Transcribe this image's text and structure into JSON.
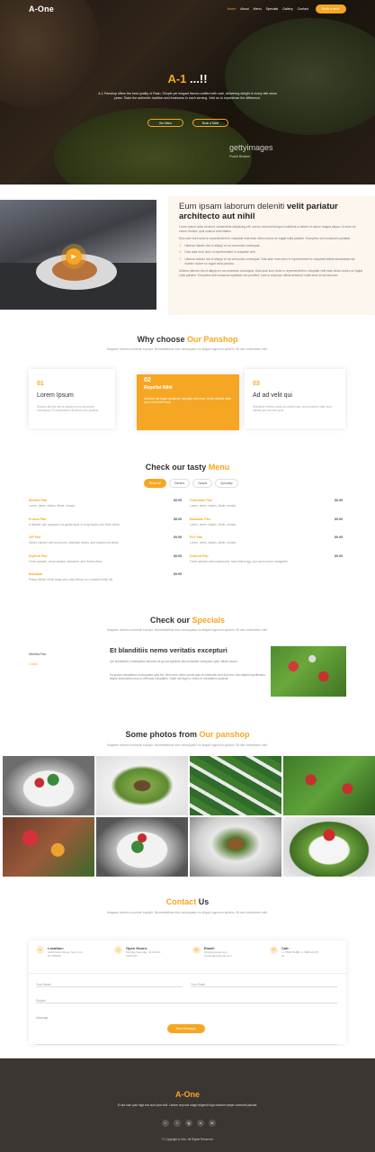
{
  "header": {
    "logo": "A-One",
    "nav": [
      "Home",
      "About",
      "Menu",
      "Specials",
      "Gallery",
      "Contact"
    ],
    "book_button": "Book a table"
  },
  "hero": {
    "title_main": "A-1",
    "title_rest": " ...!!",
    "text": "A-1 Panshop offers the best quality of Paan. Simple yet elegant flavors crafted with care, delivering delight in every bite since years. Taste the authentic tradition and freshness in each serving. Visit us to experience the difference.",
    "btn1": "Our Menu",
    "btn2": "Book a Table",
    "watermark": "gettyimages",
    "watermark_sub": "Pulkit Bhasin"
  },
  "about": {
    "heading_plain": "Eum ipsam laborum deleniti ",
    "heading_bold": "velit pariatur architecto aut nihil",
    "p1": "Lorem ipsum dolor sit amet, consectetur adipiscing elit, sed do eiusmod tempor incididunt ut labore et dolore magna aliqua. Ut enim ad minim veniam, quis nostrud exercitation.",
    "p2": "Duis aute irure dolor in reprehenderit in voluptate velit esse cillum dolore eu fugiat nulla pariatur. Excepteur sint occaecat cupidatat.",
    "checks": [
      "Ullamco laboris nisi ut aliquip ex ea commodo consequat.",
      "Duis aute irure dolor in reprehenderit in voluptate velit.",
      "Ullamco laboris nisi ut aliquip ex ea commodo consequat. Duis aute irure dolor in reprehenderit in voluptate trideta storacalaperda mastiro dolore eu fugiat nulla pariatur."
    ],
    "p3": "Ullamco laboris nisi ut aliquip ex ea commodo consequat. Duis aute irure dolor in reprehenderit in voluptate velit esse cillum dolore eu fugiat nulla pariatur. Excepteur sint occaecat cupidatat non proident, sunt in culpa qui officia deserunt mollit anim id est laborum."
  },
  "why": {
    "title_plain": "Why choose ",
    "title_accent": "Our Panshop",
    "subtitle": "Magnam dolores commodi suscipit. Necessitatibus eius consequatur ex aliquid fuga eum quidem. Sit sint consectetur velit.",
    "boxes": [
      {
        "num": "01",
        "title": "Lorem Ipsum",
        "desc": "Ulamco laboris nisi ut aliquip ex ea commodo consequat. Et consectetur ducimus vero placeat."
      },
      {
        "num": "02",
        "title": "Repellat Nihil",
        "desc": "Dolorem est fugiat occaecati voluptate velit esse. Dicta veritatis dolor quod et vel dire modi."
      },
      {
        "num": "03",
        "title": "Ad ad velit qui",
        "desc": "Molestiae officiis omnis illo asperiores. Aut doloribus vitae sunt debitis quo vel nam quis."
      }
    ]
  },
  "menu": {
    "title_plain": "Check our tasty ",
    "title_accent": "Menu",
    "filters": [
      "Show All",
      "Starters",
      "Salads",
      "Specialty"
    ],
    "items": [
      {
        "name": "Meetha Pan",
        "price": "$5.95",
        "desc": "Lorem, deren, trataro, filede, nerada"
      },
      {
        "name": "Chocolate Pan",
        "price": "$6.95",
        "desc": "Lorem, deren, trataro, filede, nerada"
      },
      {
        "name": "Frozen Pan",
        "price": "$8.95",
        "desc": "A delicate pan wrapped in a gentle layer of crisp leaves and fresh herbs"
      },
      {
        "name": "Banarasi Pan",
        "price": "$9.95",
        "desc": "Lorem, deren, trataro, filede, nerada"
      },
      {
        "name": "VIP Pan",
        "price": "$9.95",
        "desc": "Grilled chicken with provolone, artichoke hearts, and roasted red pesto"
      },
      {
        "name": "Fire Pan",
        "price": "$9.95",
        "desc": "Lorem, deren, trataro, filede, nerada"
      },
      {
        "name": "Dryfruit Pan",
        "price": "$8.95",
        "desc": "Fresh spinach, crisp romaine, tomatoes, and Greek olives"
      },
      {
        "name": "Dryfruit Pan",
        "price": "$9.95",
        "desc": "Fresh spinach with mushrooms, hard boiled egg, and warm bacon vinaigrette"
      },
      {
        "name": "Bahubali",
        "price": "$9.95",
        "desc": "Plump lobster meat, mayo and crisp lettuce on a toasted bulky roll"
      }
    ]
  },
  "specials": {
    "title_plain": "Check our ",
    "title_accent": "Specials",
    "subtitle": "Magnam dolores commodi suscipit. Necessitatibus eius consequatur ex aliquid fuga eum quidem. Sit sint consectetur velit.",
    "tabs": [
      "Meetha Pan",
      "Chikki"
    ],
    "heading": "Et blanditiis nemo veritatis excepturi",
    "p1": "Qui laudantium consequatur laborum sit qui ad sapiente dila molestiae numquam optio officiis neque.",
    "p2": "Ea ipsum voluptatem consequatur quis est. Illum error ullam omnis quia et reiciendis sunt sunt est. Non aliquid repellendus itaque accusamus eius et velit ipsa voluptates. Optio nisi fugit ut omnis et voluptatum quaerat."
  },
  "gallery": {
    "title_plain": "Some photos from ",
    "title_accent": "Our panshop",
    "subtitle": "Magnam dolores commodi suscipit. Necessitatibus eius consequatur ex aliquid fuga eum quidem. Sit sint consectetur velit."
  },
  "contact": {
    "title_accent": "Contact",
    "title_plain": " Us",
    "subtitle": "Magnam dolores commodi suscipit. Necessitatibus eius consequatur ex aliquid fuga eum quidem. Sit sint consectetur velit.",
    "info": [
      {
        "label": "Location:",
        "value": "A108 Adam Street, New York, NY 535022"
      },
      {
        "label": "Open Hours:",
        "value": "Monday-Saturday: 11:00 AM - 2300 PM"
      },
      {
        "label": "Email:",
        "value": "info@example.com contact@example.com"
      },
      {
        "label": "Call:",
        "value": "+1 5589 55488 +1 5589 22475 14"
      }
    ],
    "name_ph": "Your Name",
    "email_ph": "Your Email",
    "subject_ph": "Subject",
    "message_ph": "Message",
    "send": "Send Message"
  },
  "footer": {
    "logo": "A-One",
    "text": "Et aut eum quis fuga eos sunt ipsa nihil. Labore corporis magni eligendi fuga maxime saepe commodi placeat.",
    "socials": [
      "t",
      "f",
      "ig",
      "s",
      "in"
    ],
    "copyright": "© Copyright A-One. All Rights Reserved"
  },
  "colors": {
    "accent": "#f5a623",
    "footer_bg": "#3b3631",
    "about_bg": "#fdf6ee"
  }
}
